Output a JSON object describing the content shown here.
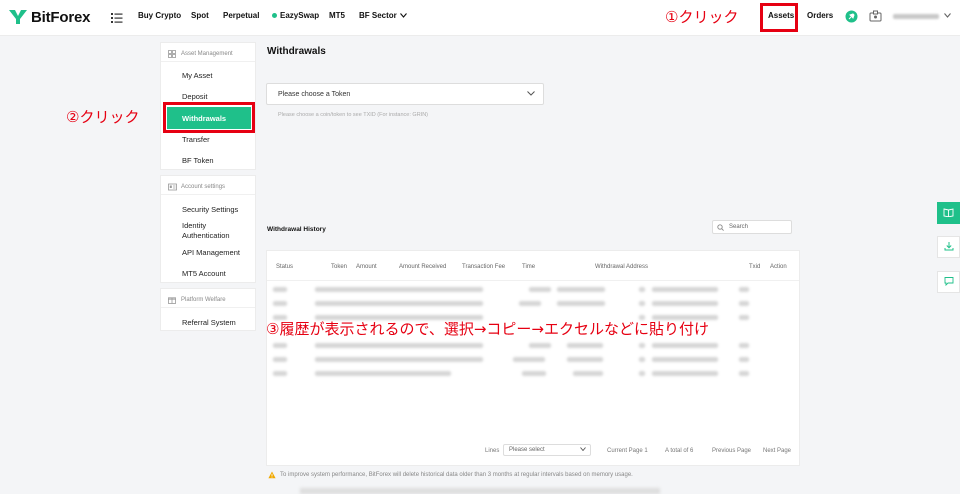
{
  "header": {
    "logo_text": "BitForex",
    "nav": [
      {
        "label": "Buy Crypto"
      },
      {
        "label": "Spot"
      },
      {
        "label": "Perpetual"
      },
      {
        "label": "EazySwap"
      },
      {
        "label": "MT5"
      },
      {
        "label": "BF Sector"
      }
    ],
    "assets_label": "Assets",
    "orders_label": "Orders"
  },
  "annotations": {
    "step1": "①クリック",
    "step2": "②クリック",
    "step3": "③履歴が表示されるので、選択→コピー→エクセルなどに貼り付け"
  },
  "sidebar": {
    "asset_management": {
      "heading": "Asset Management",
      "items": [
        {
          "label": "My Asset"
        },
        {
          "label": "Deposit"
        },
        {
          "label": "Withdrawals"
        },
        {
          "label": "Transfer"
        },
        {
          "label": "BF Token"
        }
      ]
    },
    "account_settings": {
      "heading": "Account settings",
      "items": [
        {
          "label": "Security Settings"
        },
        {
          "label": "Identity"
        },
        {
          "label": "Authentication"
        },
        {
          "label": "API Management"
        },
        {
          "label": "MT5 Account"
        }
      ]
    },
    "platform_welfare": {
      "heading": "Platform Welfare",
      "items": [
        {
          "label": "Referral System"
        }
      ]
    }
  },
  "main": {
    "title": "Withdrawals",
    "token_select_placeholder": "Please choose a Token",
    "token_hint": "Please choose a coin/token to see TXID (For instance: GRIN)",
    "history_title": "Withdrawal History",
    "search_placeholder": "Search",
    "columns": [
      "Status",
      "Token",
      "Amount",
      "Amount Received",
      "Transaction Fee",
      "Time",
      "Withdrawal Address",
      "Txid",
      "Action"
    ],
    "pager": {
      "lines_label": "Lines",
      "lines_select": "Please select",
      "current_page": "Current Page 1",
      "total": "A total of 6",
      "previous": "Previous Page",
      "next": "Next Page"
    },
    "notice": "To improve system performance, BitForex will delete historical data older than 3 months at regular intervals based on memory usage."
  },
  "colors": {
    "accent": "#1fc08a",
    "annotation_red": "#e60012"
  }
}
